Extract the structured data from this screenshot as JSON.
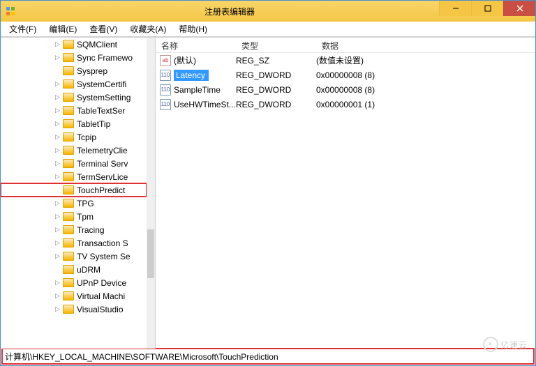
{
  "window": {
    "title": "注册表编辑器"
  },
  "menu": {
    "file": "文件(F)",
    "edit": "编辑(E)",
    "view": "查看(V)",
    "favorites": "收藏夹(A)",
    "help": "帮助(H)"
  },
  "tree": {
    "items": [
      {
        "label": "SQMClient",
        "expandable": true
      },
      {
        "label": "Sync Framewo",
        "expandable": true
      },
      {
        "label": "Sysprep",
        "expandable": false
      },
      {
        "label": "SystemCertifi",
        "expandable": true
      },
      {
        "label": "SystemSetting",
        "expandable": true
      },
      {
        "label": "TableTextSer",
        "expandable": true
      },
      {
        "label": "TabletTip",
        "expandable": true
      },
      {
        "label": "Tcpip",
        "expandable": true
      },
      {
        "label": "TelemetryClie",
        "expandable": true
      },
      {
        "label": "Terminal Serv",
        "expandable": true
      },
      {
        "label": "TermServLice",
        "expandable": true
      },
      {
        "label": "TouchPredict",
        "expandable": false,
        "highlighted": true
      },
      {
        "label": "TPG",
        "expandable": true
      },
      {
        "label": "Tpm",
        "expandable": true
      },
      {
        "label": "Tracing",
        "expandable": true
      },
      {
        "label": "Transaction S",
        "expandable": true
      },
      {
        "label": "TV System Se",
        "expandable": true
      },
      {
        "label": "uDRM",
        "expandable": false
      },
      {
        "label": "UPnP Device",
        "expandable": true
      },
      {
        "label": "Virtual Machi",
        "expandable": true
      },
      {
        "label": "VisualStudio",
        "expandable": true
      }
    ]
  },
  "list": {
    "headers": {
      "name": "名称",
      "type": "类型",
      "data": "数据"
    },
    "rows": [
      {
        "icon": "str",
        "name": "(默认)",
        "type": "REG_SZ",
        "data": "(数值未设置)",
        "selected": false
      },
      {
        "icon": "bin",
        "name": "Latency",
        "type": "REG_DWORD",
        "data": "0x00000008 (8)",
        "selected": true
      },
      {
        "icon": "bin",
        "name": "SampleTime",
        "type": "REG_DWORD",
        "data": "0x00000008 (8)",
        "selected": false
      },
      {
        "icon": "bin",
        "name": "UseHWTimeSt...",
        "type": "REG_DWORD",
        "data": "0x00000001 (1)",
        "selected": false
      }
    ]
  },
  "status": {
    "path": "计算机\\HKEY_LOCAL_MACHINE\\SOFTWARE\\Microsoft\\TouchPrediction"
  },
  "watermark": {
    "text": "亿速云"
  }
}
